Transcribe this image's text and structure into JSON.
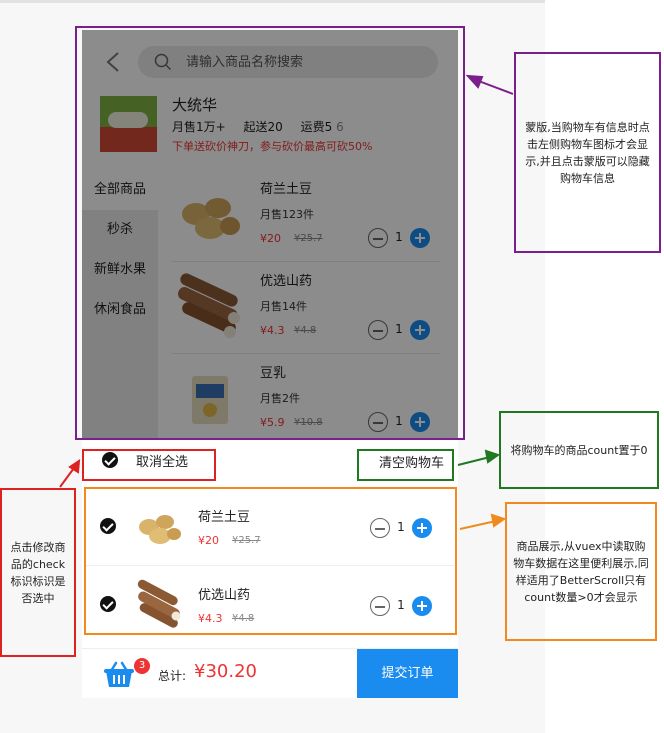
{
  "search": {
    "placeholder": "请输入商品名称搜索"
  },
  "store": {
    "name": "大统华",
    "monthly_sales": "月售1万+",
    "min_order": "起送20",
    "delivery_fee": "运费5",
    "delivery_fee_extra": "6",
    "promo": "下单送砍价神刀，参与砍价最高可砍50%"
  },
  "categories": [
    "全部商品",
    "秒杀",
    "新鲜水果",
    "休闲食品"
  ],
  "goods": [
    {
      "name": "荷兰土豆",
      "sold": "月售123件",
      "price": "¥20",
      "old_price": "¥25.7",
      "count": "1"
    },
    {
      "name": "优选山药",
      "sold": "月售14件",
      "price": "¥4.3",
      "old_price": "¥4.8",
      "count": "1"
    },
    {
      "name": "豆乳",
      "sold": "月售2件",
      "price": "¥5.9",
      "old_price": "¥10.8",
      "count": "1"
    }
  ],
  "cart": {
    "select_all_label": "取消全选",
    "clear_label": "清空购物车",
    "items": [
      {
        "name": "荷兰土豆",
        "price": "¥20",
        "old_price": "¥25.7",
        "count": "1"
      },
      {
        "name": "优选山药",
        "price": "¥4.3",
        "old_price": "¥4.8",
        "count": "1"
      }
    ]
  },
  "footer": {
    "badge": "3",
    "total_label": "总计:",
    "total_value": "¥30.20",
    "submit_label": "提交订单"
  },
  "annotations": {
    "mask_note": "蒙版,当购物车有信息时点击左侧购物车图标才会显示,并且点击蒙版可以隐藏购物车信息",
    "clear_note": "将购物车的商品count置于0",
    "list_note": "商品展示,从vuex中读取购物车数据在这里便利展示,同样适用了BetterScroll只有count数量>0才会显示",
    "check_note": "点击修改商品的check标识标识是否选中"
  },
  "colors": {
    "accent": "#1a8cf0",
    "price": "#ee3333",
    "mask_box": "#7a1f8c",
    "clear_box": "#1f7a1f",
    "list_box": "#f08a1c",
    "check_box": "#dd2222"
  }
}
